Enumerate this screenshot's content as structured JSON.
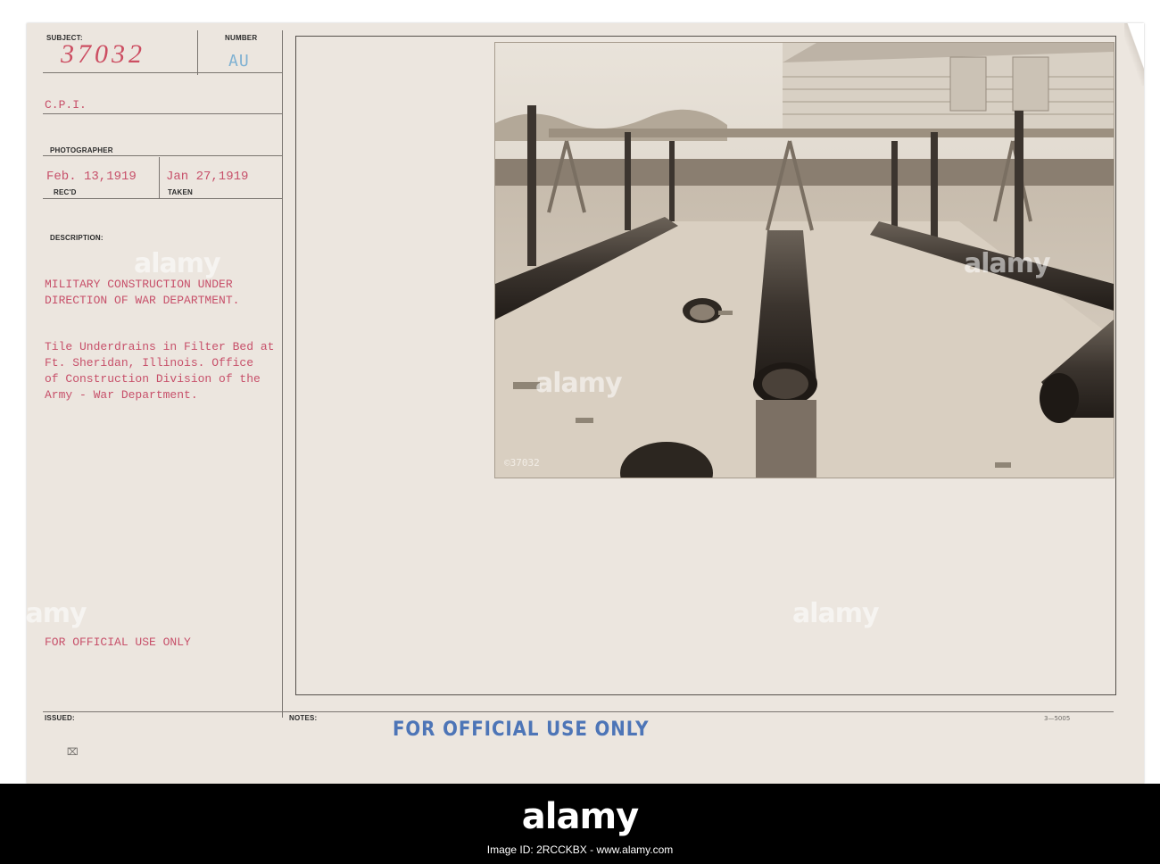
{
  "card": {
    "subject_label": "SUBJECT:",
    "number_label": "NUMBER",
    "subject_value": "37032",
    "number_value": "AU",
    "source": "C.P.I.",
    "photographer_label": "PHOTOGRAPHER",
    "recd_date": "Feb. 13,1919",
    "taken_date": "Jan 27,1919",
    "recd_label": "REC'D",
    "taken_label": "TAKEN",
    "description_label": "DESCRIPTION:",
    "description_lines": [
      "MILITARY CONSTRUCTION UNDER",
      "DIRECTION OF WAR DEPARTMENT."
    ],
    "caption_lines": [
      "Tile Underdrains in Filter Bed at",
      "Ft. Sheridan, Illinois.  Office",
      "of Construction Division of the",
      "Army - War Department."
    ],
    "official_use": "FOR OFFICIAL USE ONLY",
    "issued_label": "ISSUED:",
    "notes_label": "NOTES:",
    "form_code": "3—5005",
    "photo_negative_number": "©37032",
    "stamp_text": "FOR OFFICIAL USE ONLY"
  },
  "footer": {
    "brand": "alamy",
    "image_id": "Image ID: 2RCCKBX",
    "image_id_url": "www.alamy.com"
  },
  "watermark": "alamy"
}
